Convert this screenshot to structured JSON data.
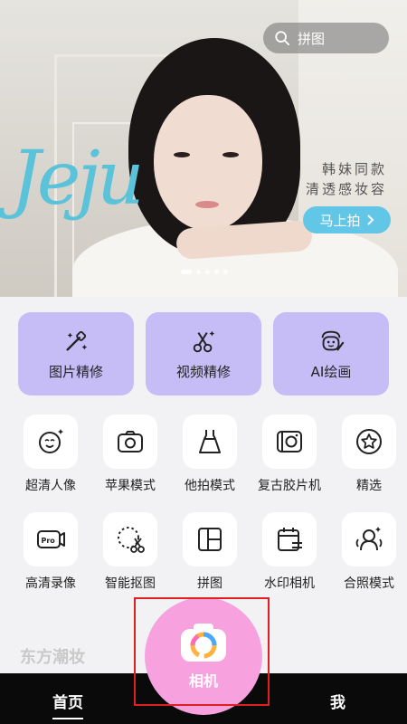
{
  "hero": {
    "brand_text": "Jeju",
    "search_placeholder": "拼图",
    "promo_line1": "韩妹同款",
    "promo_line2": "清透感妆容",
    "cta_label": "马上拍",
    "slide_count": 5,
    "active_slide": 1
  },
  "features": [
    {
      "label": "图片精修",
      "icon": "photo-retouch-icon"
    },
    {
      "label": "视频精修",
      "icon": "video-retouch-icon"
    },
    {
      "label": "AI绘画",
      "icon": "ai-paint-icon"
    }
  ],
  "tools": [
    {
      "label": "超清人像",
      "icon": "portrait-face-icon"
    },
    {
      "label": "苹果模式",
      "icon": "camera-icon"
    },
    {
      "label": "他拍模式",
      "icon": "dress-icon"
    },
    {
      "label": "复古胶片机",
      "icon": "film-camera-icon"
    },
    {
      "label": "精选",
      "icon": "star-icon"
    },
    {
      "label": "高清录像",
      "icon": "pro-video-icon"
    },
    {
      "label": "智能抠图",
      "icon": "cutout-icon"
    },
    {
      "label": "拼图",
      "icon": "collage-icon"
    },
    {
      "label": "水印相机",
      "icon": "watermark-camera-icon"
    },
    {
      "label": "合照模式",
      "icon": "group-photo-icon"
    }
  ],
  "section_title": "东方潮妆",
  "nav": {
    "home": "首页",
    "camera": "相机",
    "me": "我"
  },
  "colors": {
    "feature_card": "#c7bdf6",
    "cta": "#62c6e6",
    "camera_fab": "#f7a2de",
    "nav_bg": "#0a0a0a",
    "highlight": "#e02020"
  }
}
